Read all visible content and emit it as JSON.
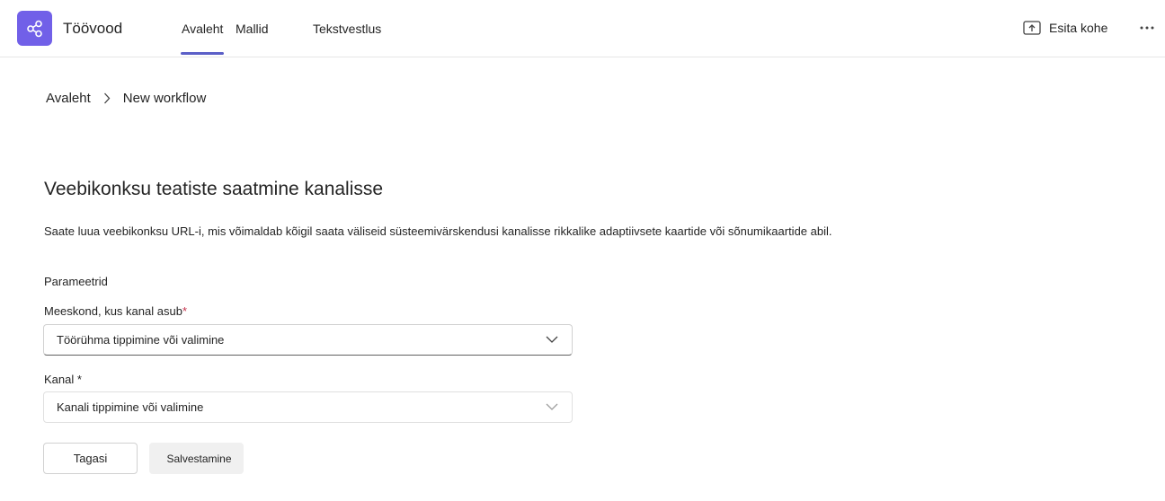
{
  "header": {
    "app_icon": "workflow-icon",
    "app_title": "Töövood",
    "tabs": [
      {
        "label": "Avaleht",
        "active": true
      },
      {
        "label": "Mallid",
        "active": false
      },
      {
        "label": "Tekstvestlus",
        "active": false
      }
    ],
    "present_label": "Esita kohe",
    "present_icon": "share-screen-icon",
    "more_icon": "more-horizontal-icon"
  },
  "breadcrumb": {
    "home": "Avaleht",
    "separator_icon": "chevron-right-icon",
    "current": "New workflow"
  },
  "main": {
    "title": "Veebikonksu teatiste saatmine kanalisse",
    "description": "Saate luua veebikonksu URL-i, mis võimaldab kõigil saata väliseid süsteemivärskendusi kanalisse rikkalike adaptiivsete kaartide või sõnumikaartide abil.",
    "parameters_label": "Parameetrid",
    "team_field": {
      "label": "Meeskond, kus kanal asub",
      "required_mark": "*",
      "placeholder": "Töörühma tippimine või valimine"
    },
    "channel_field": {
      "label": "Kanal",
      "required_mark": " *",
      "placeholder": "Kanali tippimine või valimine"
    },
    "back_label": "Tagasi",
    "save_label": "Salvestamine"
  },
  "colors": {
    "accent": "#5b5fc7",
    "app_icon_bg": "#7160e8",
    "required": "#c4314b"
  }
}
